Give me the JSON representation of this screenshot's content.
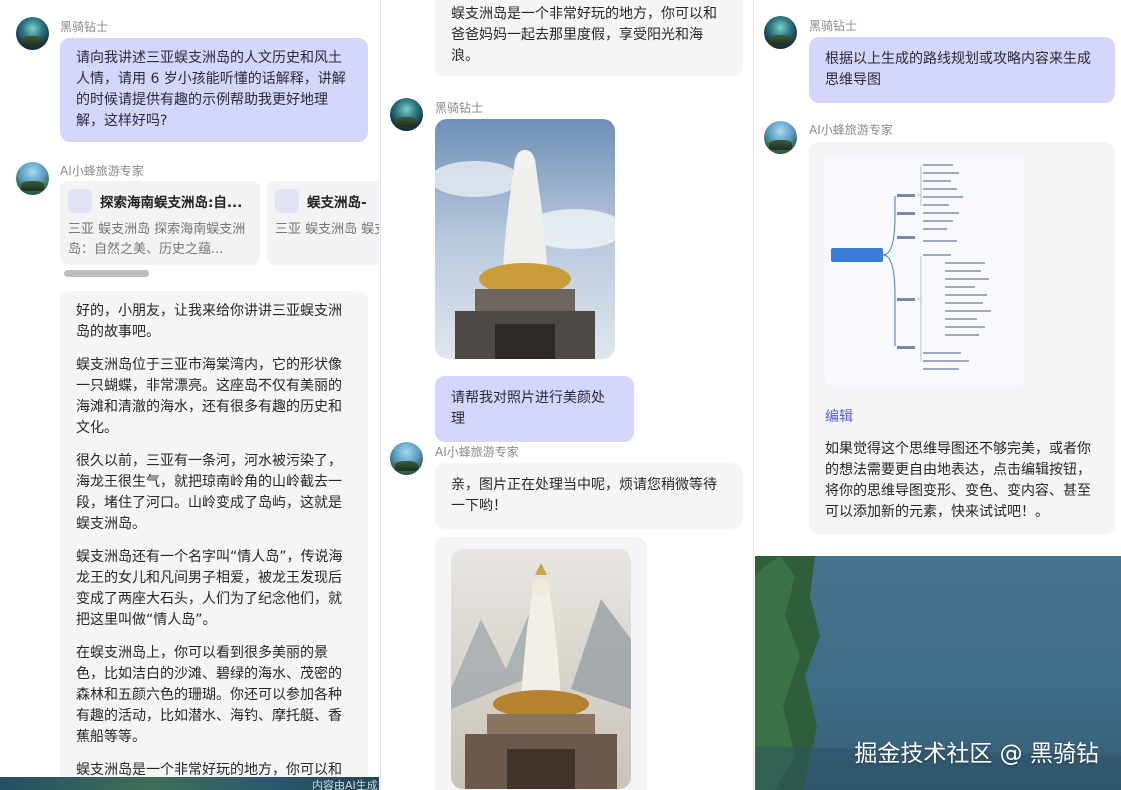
{
  "colors": {
    "user_bubble": "#d4d6fb",
    "ai_bubble": "#f5f5f7",
    "link": "#5b5bd6"
  },
  "panel1": {
    "user_name": "黑骑钻士",
    "user_message": "请向我讲述三亚蜈支洲岛的人文历史和风土人情，请用 6 岁小孩能听懂的话解释，讲解的时候请提供有趣的示例帮助我更好地理解，这样好吗?",
    "ai_name": "AI小蜂旅游专家",
    "ref_cards": [
      {
        "title": "探索海南蜈支洲岛:自...",
        "desc": "三亚 蜈支洲岛 探索海南蜈支洲岛：自然之美、历史之蕴..."
      },
      {
        "title": "蜈支洲岛-",
        "desc": "三亚 蜈支洲岛 蜈支洲岛是一个充满"
      }
    ],
    "ai_paragraphs": [
      "好的，小朋友，让我来给你讲讲三亚蜈支洲岛的故事吧。",
      "蜈支洲岛位于三亚市海棠湾内，它的形状像一只蝴蝶，非常漂亮。这座岛不仅有美丽的海滩和清澈的海水，还有很多有趣的历史和文化。",
      "很久以前，三亚有一条河，河水被污染了，海龙王很生气，就把琼南岭角的山岭截去一段，堵住了河口。山岭变成了岛屿，这就是蜈支洲岛。",
      "蜈支洲岛还有一个名字叫“情人岛”，传说海龙王的女儿和凡间男子相爱，被龙王发现后变成了两座大石头，人们为了纪念他们，就把这里叫做“情人岛”。",
      "在蜈支洲岛上，你可以看到很多美丽的景色，比如洁白的沙滩、碧绿的海水、茂密的森林和五颜六色的珊瑚。你还可以参加各种有趣的活动，比如潜水、海钓、摩托艇、香蕉船等等。",
      "蜈支洲岛是一个非常好玩的地方，你可以和"
    ],
    "bottom_text": "内容由AI生成"
  },
  "panel2": {
    "ai_top_fragment": "蜈支洲岛是一个非常好玩的地方，你可以和爸爸妈妈一起去那里度假，享受阳光和海浪。",
    "user_name": "黑骑钻士",
    "user_image_icon": "guanyin-statue-photo",
    "user_message": "请帮我对照片进行美颜处理",
    "ai_name": "AI小蜂旅游专家",
    "ai_message": "亲，图片正在处理当中呢，烦请您稍微等待一下哟！",
    "ai_image_icon": "stylized-guanyin-painting"
  },
  "panel3": {
    "user_name": "黑骑钻士",
    "user_message": "根据以上生成的路线规划或攻略内容来生成思维导图",
    "ai_name": "AI小蜂旅游专家",
    "mindmap_icon": "mind-map-thumbnail",
    "edit_label": "编辑",
    "ai_message": "如果觉得这个思维导图还不够完美，或者你的想法需要更自由地表达，点击编辑按钮，将你的思维导图变形、变色、变内容、甚至可以添加新的元素，快来试试吧！。"
  },
  "watermark": "掘金技术社区 @ 黑骑钻"
}
